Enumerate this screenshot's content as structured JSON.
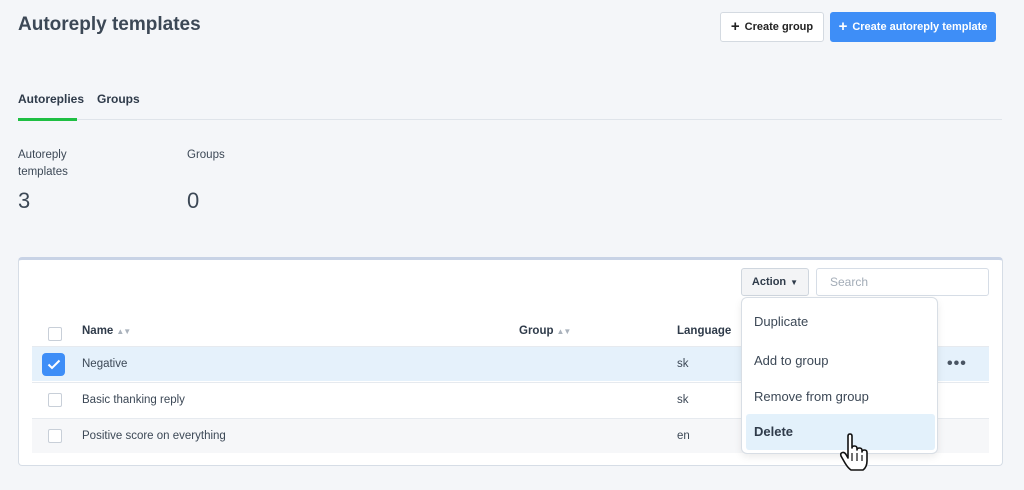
{
  "page": {
    "title": "Autoreply templates",
    "create_group_label": "Create group",
    "create_template_label": "Create autoreply template"
  },
  "tabs": [
    {
      "label": "Autoreplies",
      "active": true
    },
    {
      "label": "Groups",
      "active": false
    }
  ],
  "stats": {
    "templates": {
      "label": "Autoreply templates",
      "value": "3"
    },
    "groups": {
      "label": "Groups",
      "value": "0"
    }
  },
  "toolbar": {
    "action_label": "Action",
    "search_placeholder": "Search"
  },
  "table": {
    "columns": {
      "name": "Name",
      "group": "Group",
      "language": "Language"
    },
    "rows": [
      {
        "name": "Negative",
        "group": "",
        "language": "sk",
        "selected": true
      },
      {
        "name": "Basic thanking reply",
        "group": "",
        "language": "sk",
        "selected": false
      },
      {
        "name": "Positive score on everything",
        "group": "",
        "language": "en",
        "selected": false
      }
    ]
  },
  "action_menu": {
    "items": [
      "Duplicate",
      "Add to group",
      "Remove from group",
      "Delete"
    ],
    "hovered": "Delete"
  },
  "colors": {
    "primary": "#3e8ef7",
    "tab_active": "#1fbf43",
    "row_selected": "#e5f1fb"
  }
}
